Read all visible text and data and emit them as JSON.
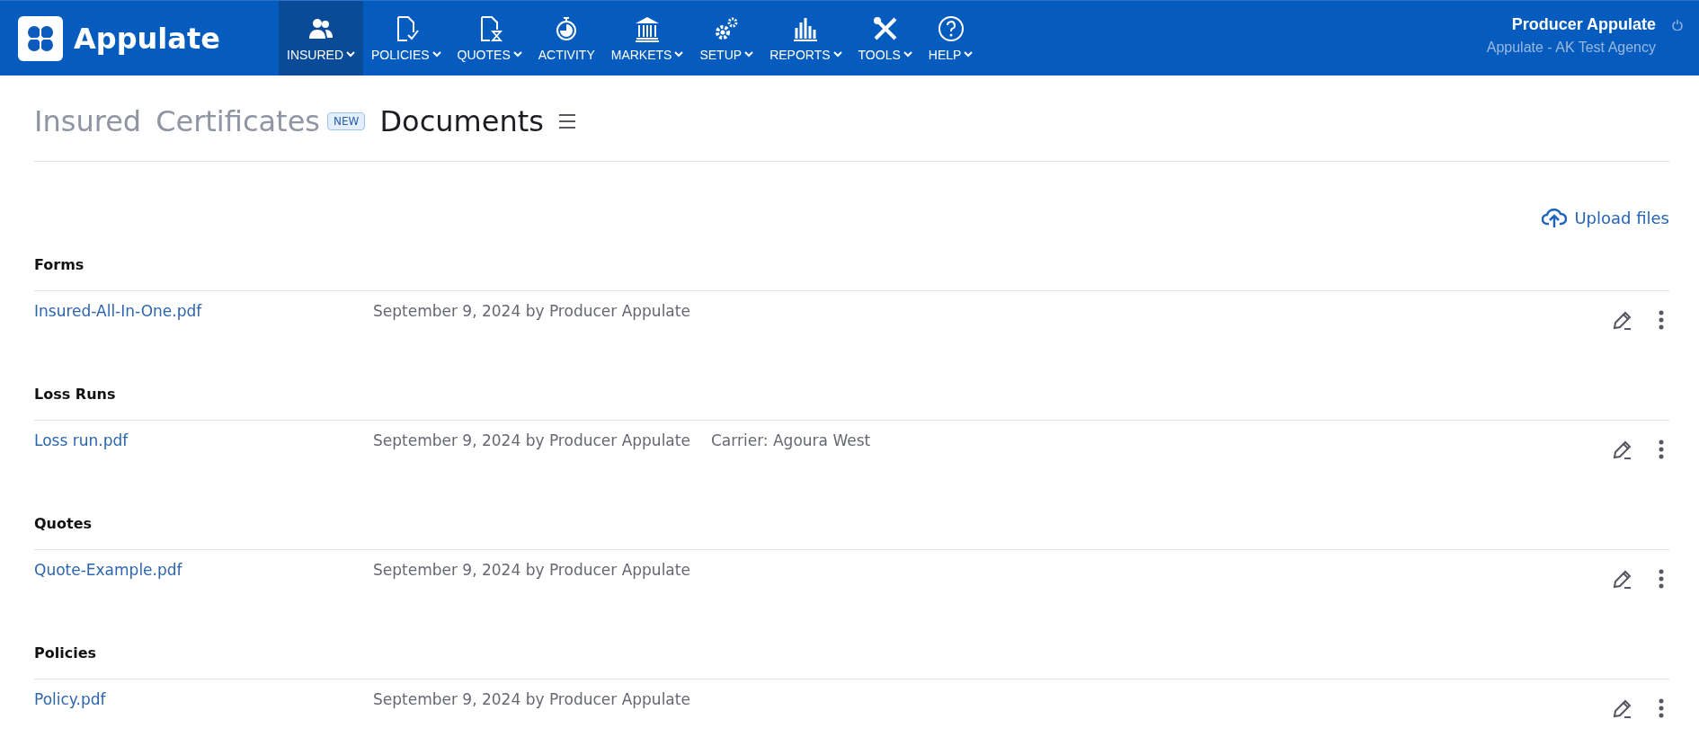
{
  "header": {
    "logo_text": "Appulate",
    "nav": [
      {
        "label": "INSURED",
        "dropdown": true,
        "selected": true
      },
      {
        "label": "POLICIES",
        "dropdown": true,
        "selected": false
      },
      {
        "label": "QUOTES",
        "dropdown": true,
        "selected": false
      },
      {
        "label": "ACTIVITY",
        "dropdown": false,
        "selected": false
      },
      {
        "label": "MARKETS",
        "dropdown": true,
        "selected": false
      },
      {
        "label": "SETUP",
        "dropdown": true,
        "selected": false
      },
      {
        "label": "REPORTS",
        "dropdown": true,
        "selected": false
      },
      {
        "label": "TOOLS",
        "dropdown": true,
        "selected": false
      },
      {
        "label": "HELP",
        "dropdown": true,
        "selected": false
      }
    ],
    "user": {
      "name": "Producer Appulate",
      "agency": "Appulate - AK Test Agency"
    }
  },
  "page_tabs": [
    {
      "label": "Insured",
      "selected": false
    },
    {
      "label": "Certificates",
      "selected": false,
      "badge": "NEW"
    },
    {
      "label": "Documents",
      "selected": true
    }
  ],
  "upload": {
    "label": "Upload files"
  },
  "sections": [
    {
      "title": "Forms",
      "documents": [
        {
          "name": "Insured-All-In-One.pdf",
          "meta": "September 9, 2024 by Producer Appulate"
        }
      ]
    },
    {
      "title": "Loss Runs",
      "documents": [
        {
          "name": "Loss run.pdf",
          "meta": "September 9, 2024 by Producer Appulate",
          "carrier": "Carrier: Agoura West"
        }
      ]
    },
    {
      "title": "Quotes",
      "documents": [
        {
          "name": "Quote-Example.pdf",
          "meta": "September 9, 2024 by Producer Appulate"
        }
      ]
    },
    {
      "title": "Policies",
      "documents": [
        {
          "name": "Policy.pdf",
          "meta": "September 9, 2024 by Producer Appulate"
        }
      ]
    }
  ]
}
